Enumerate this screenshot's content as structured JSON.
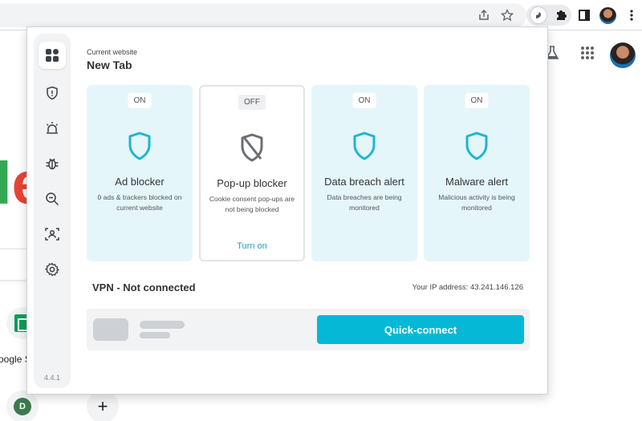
{
  "browser": {
    "toolbar_icons": [
      "share-icon",
      "star-icon",
      "surfshark-extension-icon",
      "puzzle-icon",
      "side-panel-icon",
      "profile-avatar",
      "more-menu-icon"
    ]
  },
  "new_tab": {
    "logo_fragment_l": "l",
    "logo_fragment_e": "e",
    "shortcut_label": "oogle S",
    "shortcut_d_letter": "D",
    "add_shortcut": "+"
  },
  "popup": {
    "current_website_label": "Current website",
    "current_website": "New Tab",
    "version": "4.4.1",
    "nav": [
      "dashboard-icon",
      "shield-icon",
      "alarm-icon",
      "bug-icon",
      "search-zoom-icon",
      "person-scan-icon",
      "gear-icon"
    ],
    "cards": [
      {
        "status": "ON",
        "title": "Ad blocker",
        "desc": "0 ads & trackers blocked on current website",
        "link": ""
      },
      {
        "status": "OFF",
        "title": "Pop-up blocker",
        "desc": "Cookie consent pop-ups are not being blocked",
        "link": "Turn on"
      },
      {
        "status": "ON",
        "title": "Data breach alert",
        "desc": "Data breaches are being monitored",
        "link": ""
      },
      {
        "status": "ON",
        "title": "Malware alert",
        "desc": "Malicious activity is being monitored",
        "link": ""
      }
    ],
    "vpn": {
      "title": "VPN - Not connected",
      "ip_label": "Your IP address: 43.241.146.126",
      "button": "Quick-connect"
    }
  },
  "colors": {
    "accent": "#05b9d6",
    "card_on_bg": "#e4f6fa",
    "shield_on": "#1bb6d1",
    "shield_off": "#6b6f75"
  }
}
